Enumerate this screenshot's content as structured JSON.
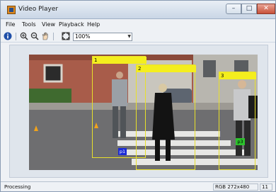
{
  "window": {
    "title": "Video Player"
  },
  "menu": [
    "File",
    "Tools",
    "View",
    "Playback",
    "Help"
  ],
  "toolbar": {
    "zoom": "100%"
  },
  "detections": [
    {
      "label": "1",
      "id_tag": "p1"
    },
    {
      "label": "2",
      "id_tag": ""
    },
    {
      "label": "3",
      "id_tag": "p3"
    }
  ],
  "status": {
    "text": "Processing",
    "info": "RGB 272x480",
    "frame": "11"
  },
  "colors": {
    "bbox": "#e8e02a",
    "bbox_label": "#f4ee1e",
    "id_tag_blue": "#1b2bd6",
    "id_tag_green": "#2cc22c"
  },
  "icons": [
    "info-icon",
    "zoom-in-icon",
    "zoom-out-icon",
    "pan-icon",
    "fit-icon"
  ]
}
